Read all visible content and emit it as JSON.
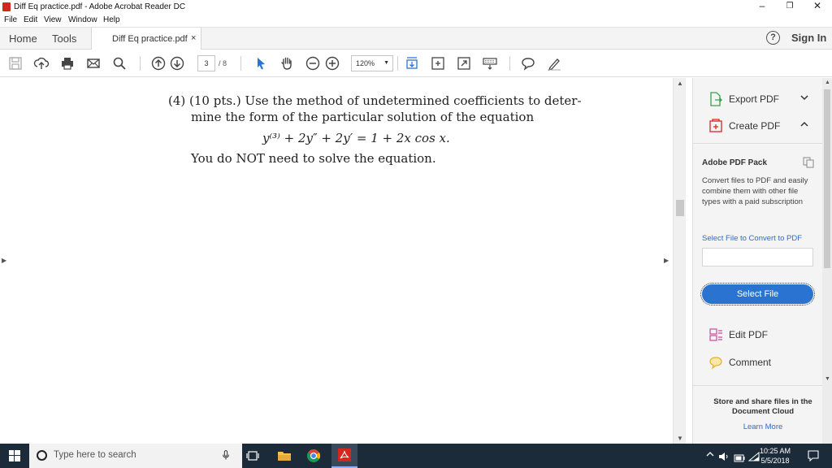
{
  "window": {
    "title": "Diff Eq practice.pdf - Adobe Acrobat Reader DC",
    "minimize": "–",
    "restore": "❐",
    "close": "✕"
  },
  "menu": [
    "File",
    "Edit",
    "View",
    "Window",
    "Help"
  ],
  "tabs": {
    "home": "Home",
    "tools": "Tools",
    "doc": "Diff Eq practice.pdf",
    "doc_close": "×",
    "help": "?",
    "signin": "Sign In"
  },
  "toolbar": {
    "page_current": "3",
    "page_total": "/ 8",
    "zoom": "120%",
    "zoom_caret": "▼"
  },
  "document": {
    "line1": "(4) (10 pts.) Use the method of undetermined coefficients to deter-",
    "line2": "mine the form of the particular solution of the equation",
    "equation": "y⁽³⁾ + 2y″ + 2y′ = 1 + 2x cos x.",
    "line3": "You do NOT need to solve the equation."
  },
  "right_pane": {
    "export_pdf": "Export PDF",
    "create_pdf": "Create PDF",
    "pack_title": "Adobe PDF Pack",
    "pack_desc": "Convert files to PDF and easily combine them with other file types with a paid subscription",
    "select_link": "Select File to Convert to PDF",
    "select_button": "Select File",
    "edit_pdf": "Edit PDF",
    "comment": "Comment",
    "store_text": "Store and share files in the Document Cloud",
    "learn_more": "Learn More"
  },
  "taskbar": {
    "search_placeholder": "Type here to search",
    "time": "10:25 AM",
    "date": "5/5/2018"
  },
  "colors": {
    "accent": "#2b73d0",
    "acrobat_red": "#d6271f",
    "taskbar": "#1c2b3a"
  }
}
